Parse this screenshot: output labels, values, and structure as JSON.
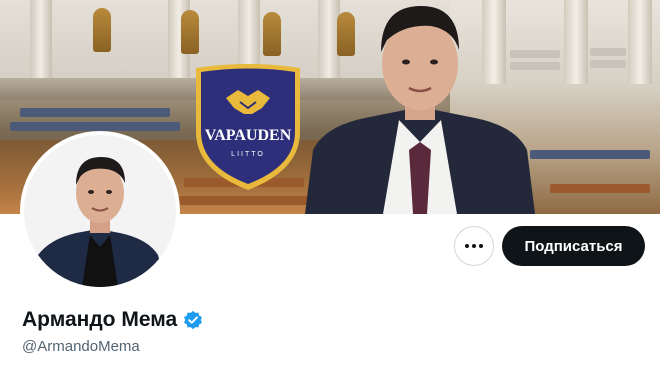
{
  "profile": {
    "display_name": "Армандо Мема",
    "handle": "@ArmandoMema",
    "verified": true
  },
  "banner": {
    "logo_text": "VAPAUDEN",
    "logo_subtext": "LIITTO"
  },
  "actions": {
    "more_icon": "more-horizontal-icon",
    "follow_label": "Подписаться"
  },
  "colors": {
    "follow_button_bg": "#0f1419",
    "verified_blue": "#1d9bf0",
    "logo_navy": "#2d2f7a",
    "logo_gold": "#e8b93a"
  }
}
